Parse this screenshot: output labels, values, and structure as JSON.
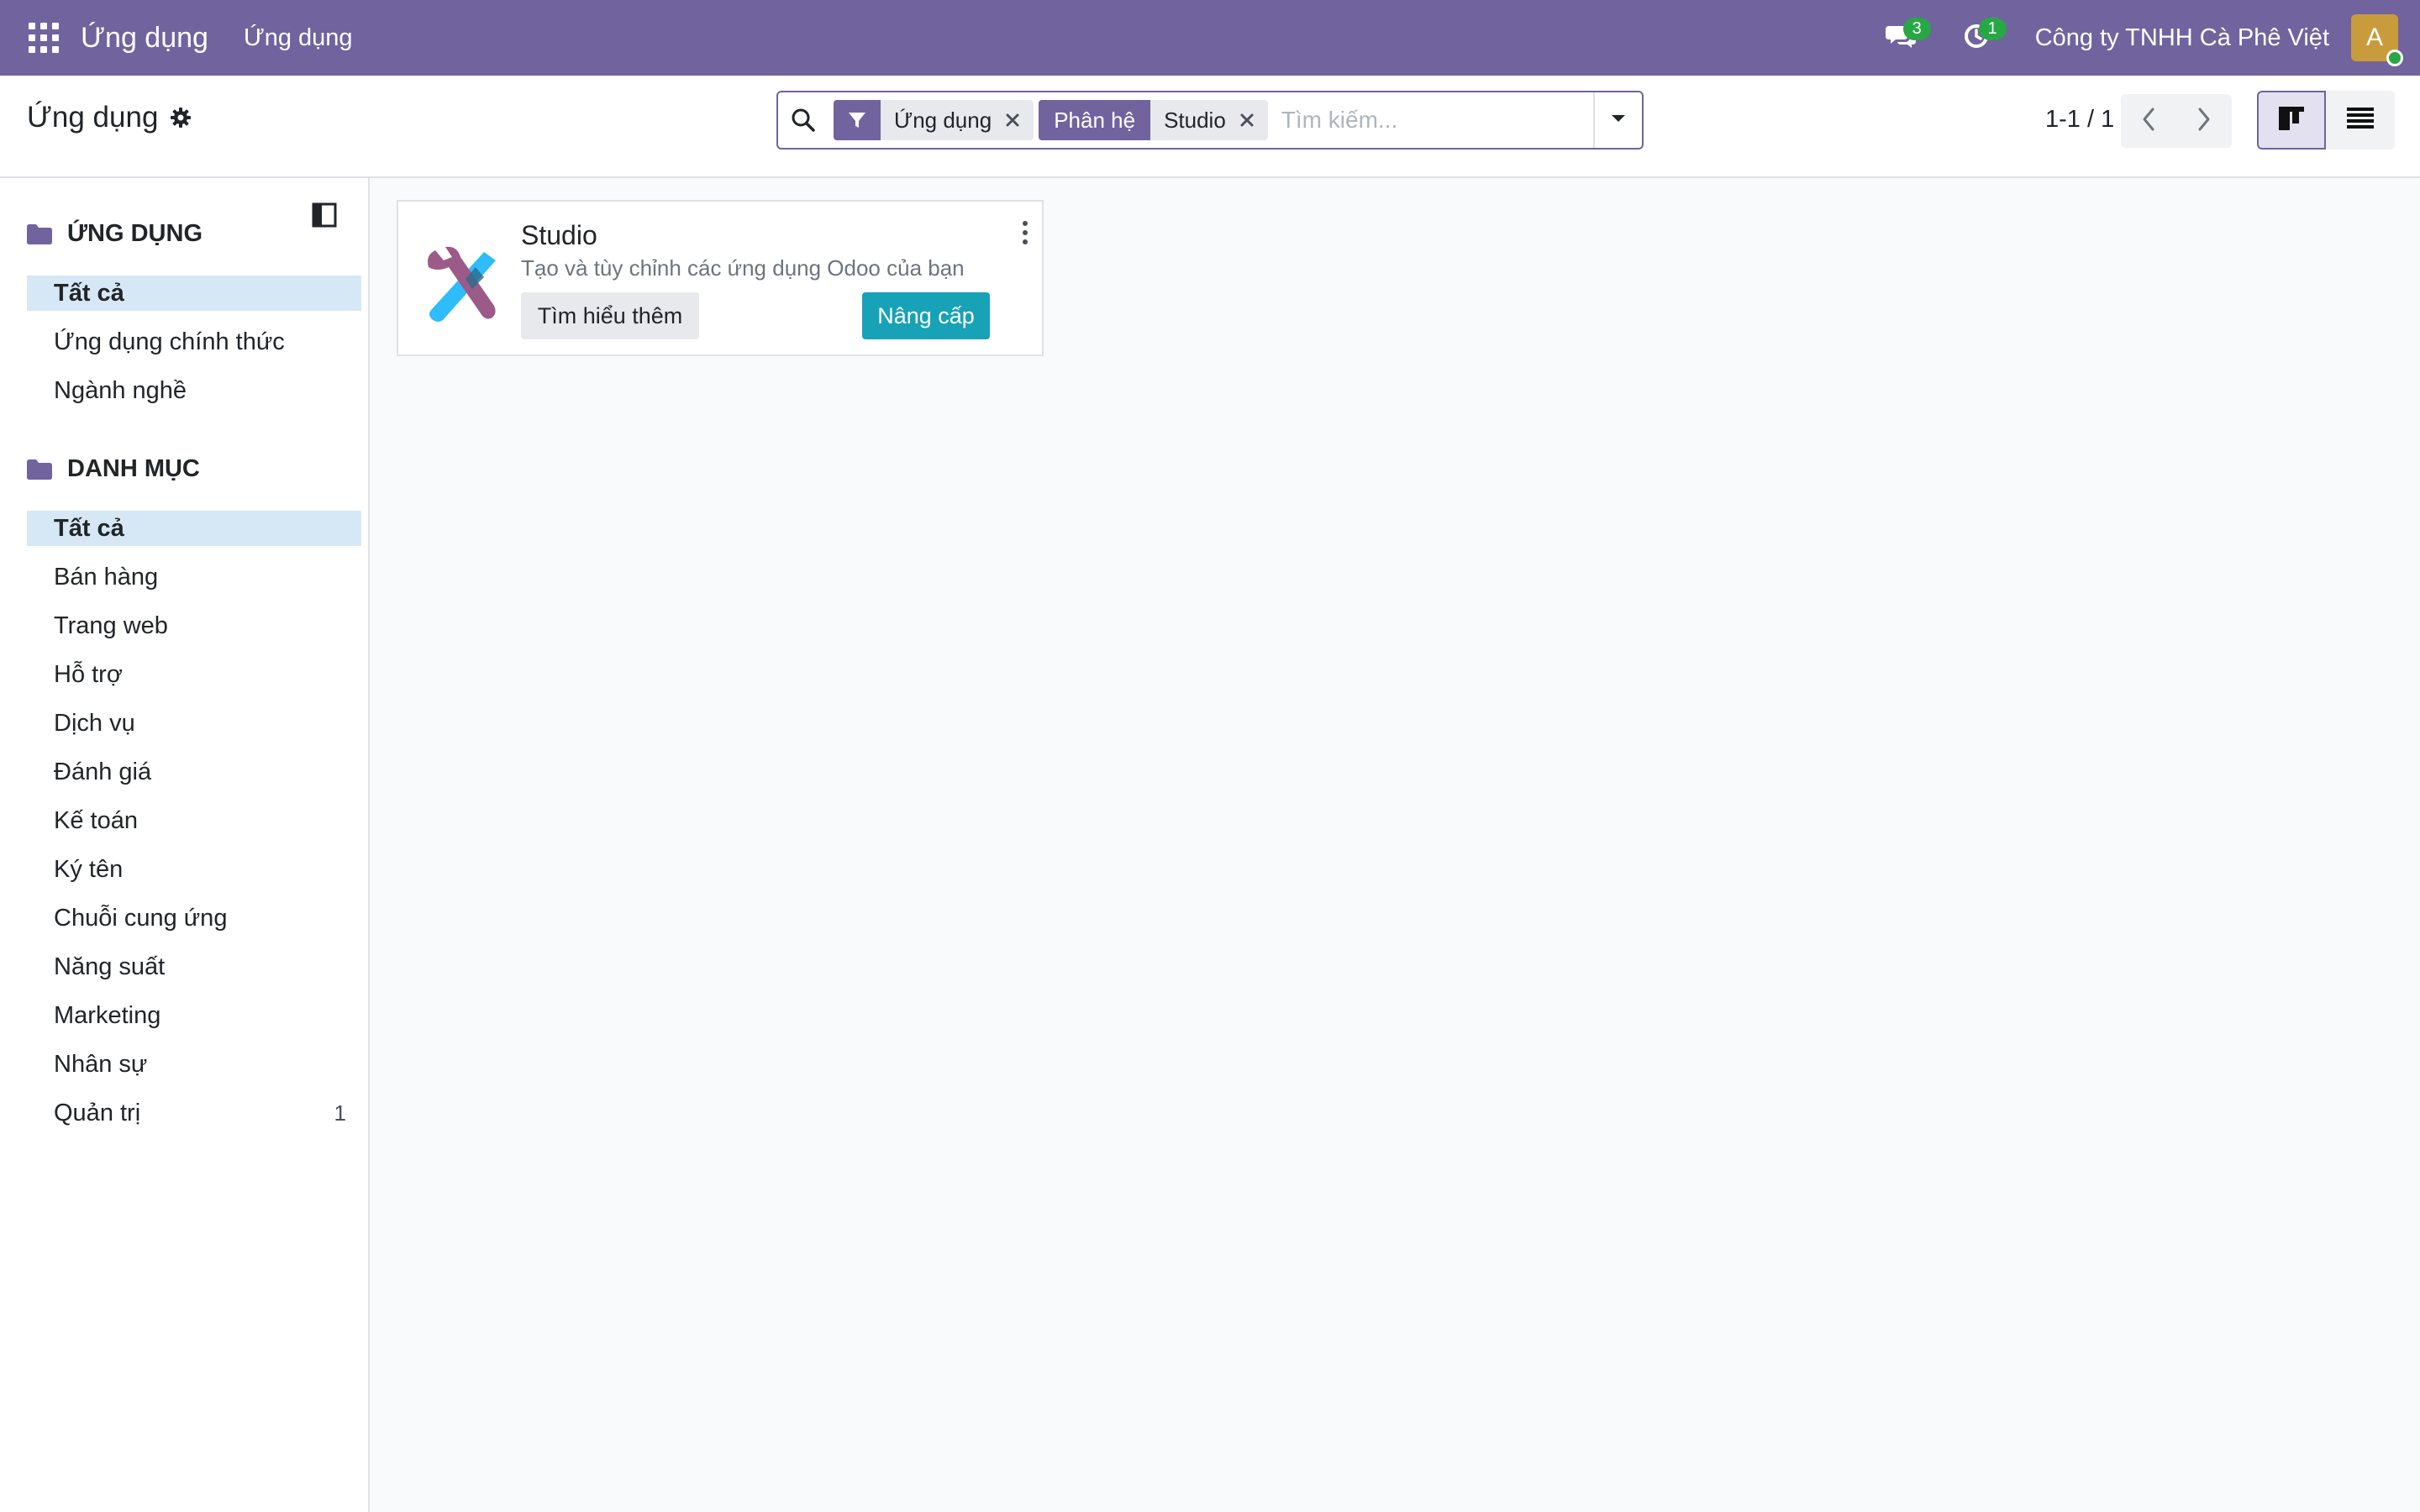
{
  "navbar": {
    "brand": "Ứng dụng",
    "menu_item": "Ứng dụng",
    "messages_count": "3",
    "activities_count": "1",
    "company": "Công ty TNHH Cà Phê Việt",
    "avatar_letter": "A"
  },
  "control_panel": {
    "breadcrumb": "Ứng dụng",
    "search": {
      "facets": [
        {
          "category": "",
          "value": "Ứng dụng",
          "icon": "filter-icon"
        },
        {
          "category": "Phân hệ",
          "value": "Studio"
        }
      ],
      "placeholder": "Tìm kiếm..."
    },
    "pager": "1-1 / 1"
  },
  "sidebar": {
    "sections": [
      {
        "title": "ỨNG DỤNG",
        "items": [
          {
            "label": "Tất cả",
            "active": true
          },
          {
            "label": "Ứng dụng chính thức"
          },
          {
            "label": "Ngành nghề"
          }
        ]
      },
      {
        "title": "DANH MỤC",
        "items": [
          {
            "label": "Tất cả",
            "active": true
          },
          {
            "label": "Bán hàng"
          },
          {
            "label": "Trang web"
          },
          {
            "label": "Hỗ trợ"
          },
          {
            "label": "Dịch vụ"
          },
          {
            "label": "Đánh giá"
          },
          {
            "label": "Kế toán"
          },
          {
            "label": "Ký tên"
          },
          {
            "label": "Chuỗi cung ứng"
          },
          {
            "label": "Năng suất"
          },
          {
            "label": "Marketing"
          },
          {
            "label": "Nhân sự"
          },
          {
            "label": "Quản trị",
            "count": "1"
          }
        ]
      }
    ]
  },
  "cards": [
    {
      "title": "Studio",
      "description": "Tạo và tùy chỉnh các ứng dụng Odoo của bạn",
      "learn_more": "Tìm hiểu thêm",
      "upgrade": "Nâng cấp"
    }
  ],
  "colors": {
    "navbar": "#71639e",
    "active_item": "#d6e8f5",
    "upgrade_button": "#17a2b8",
    "badge": "#28a745"
  }
}
